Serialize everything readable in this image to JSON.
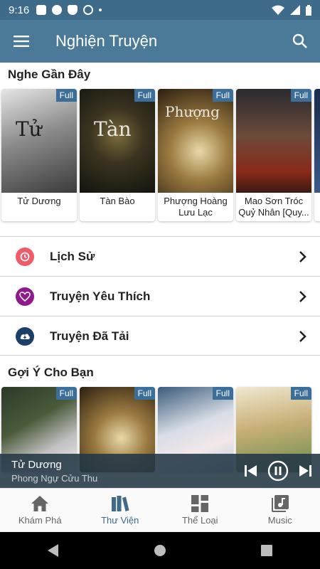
{
  "status_bar": {
    "time": "9:16"
  },
  "app_bar": {
    "title": "Nghiện Truyện"
  },
  "recent": {
    "title": "Nghe Gần Đây",
    "items": [
      {
        "name": "Tử Dương",
        "tag": "Full",
        "art": "Tử"
      },
      {
        "name": "Tàn Bào",
        "tag": "Full",
        "art": "Tàn"
      },
      {
        "name": "Phượng Hoàng Lưu Lạc",
        "tag": "Full",
        "art": "Phượng"
      },
      {
        "name": "Mao Sơn Tróc Quỷ Nhân [Quy...",
        "tag": "Full",
        "art": ""
      }
    ]
  },
  "menu": {
    "history": "Lịch Sử",
    "favorites": "Truyện Yêu Thích",
    "downloaded": "Truyện Đã Tải"
  },
  "suggest": {
    "title": "Gợi Ý Cho Bạn",
    "items": [
      {
        "tag": "Full"
      },
      {
        "tag": "Full"
      },
      {
        "tag": "Full"
      },
      {
        "tag": "Full"
      }
    ]
  },
  "player": {
    "track": "Tử Dương",
    "artist": "Phong Ngự Cửu Thu"
  },
  "nav": {
    "explore": "Khám Phá",
    "library": "Thư Viện",
    "genres": "Thể Loại",
    "music": "Music"
  }
}
